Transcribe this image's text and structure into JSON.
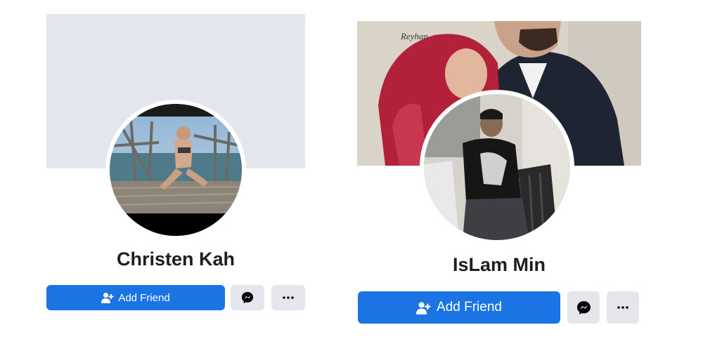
{
  "profiles": [
    {
      "name": "Christen Kah",
      "add_friend_label": "Add Friend",
      "cover": "blank-cover",
      "avatar": "profile-photo-woman-on-pier"
    },
    {
      "name": "IsLam Min",
      "add_friend_label": "Add Friend",
      "cover": "couple-photo-cover",
      "avatar": "profile-photo-man-sitting"
    }
  ],
  "cover_watermark": "Reyhan",
  "colors": {
    "primary_button": "#1b74e4",
    "secondary_button": "#e4e6eb",
    "cover_blank": "#e4e6ee",
    "text": "#1c1e21"
  },
  "icons": [
    "add-friend-icon",
    "messenger-icon",
    "more-icon"
  ]
}
